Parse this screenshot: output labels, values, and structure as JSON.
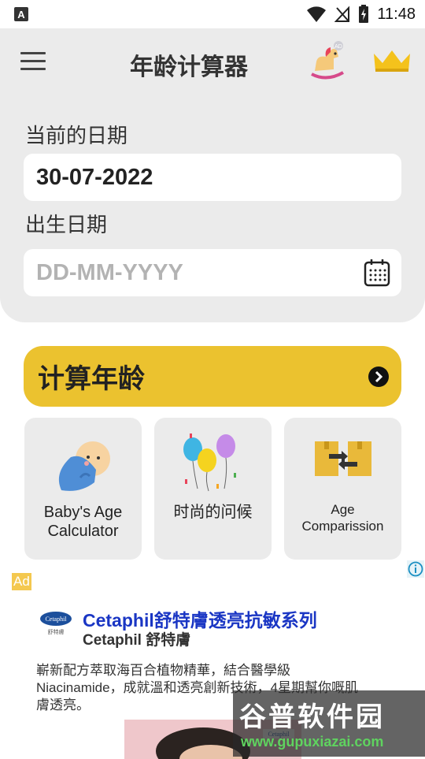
{
  "status_bar": {
    "time": "11:48",
    "icons": [
      "notification-a-icon",
      "wifi-icon",
      "no-signal-icon",
      "battery-charging-icon"
    ]
  },
  "header": {
    "title": "年龄计算器",
    "icons": [
      "menu-icon",
      "rocking-horse-icon",
      "crown-icon"
    ]
  },
  "form": {
    "current_date_label": "当前的日期",
    "current_date_value": "30-07-2022",
    "birth_date_label": "出生日期",
    "birth_date_placeholder": "DD-MM-YYYY"
  },
  "calculate_button": {
    "label": "计算年龄"
  },
  "feature_cards": [
    {
      "label": "Baby's Age Calculator",
      "icon": "baby-icon"
    },
    {
      "label": "时尚的问候",
      "icon": "balloons-icon"
    },
    {
      "label": "Age Comparission",
      "icon": "compare-boxes-icon"
    }
  ],
  "ad": {
    "badge": "Ad",
    "title": "Cetaphil舒特膚透亮抗敏系列",
    "subtitle": "Cetaphil 舒特膚",
    "body": "嶄新配方萃取海百合植物精華，結合醫學級Niacinamide，成就溫和透亮創新技術，4星期幫你嘅肌膚透亮。",
    "logo_text": "Cetaphil",
    "logo_subtext": "舒特膚",
    "image_caption": "Cetaphil"
  },
  "watermark": {
    "main": "谷普软件园",
    "url": "www.gupuxiazai.com"
  },
  "colors": {
    "accent": "#ebc22f",
    "panel": "#ebebeb",
    "ad_title": "#1a36c4",
    "watermark_url": "#5fd35f"
  }
}
